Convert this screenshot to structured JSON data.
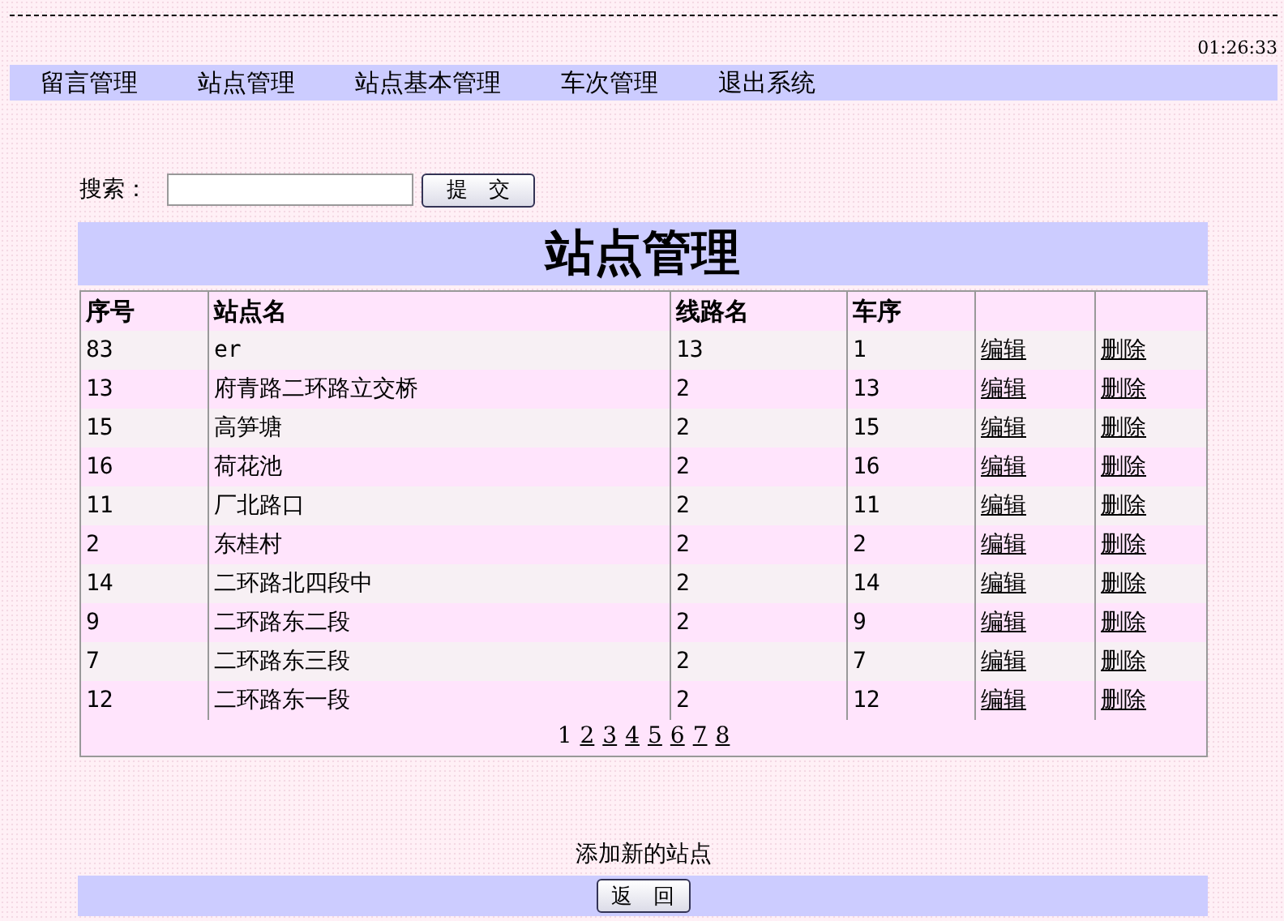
{
  "clock": "01:26:33",
  "nav": [
    "留言管理",
    "站点管理",
    "站点基本管理",
    "车次管理",
    "退出系统"
  ],
  "search": {
    "label": "搜索：",
    "button": "提　交"
  },
  "title": "站点管理",
  "table": {
    "columns": [
      "序号",
      "站点名",
      "线路名",
      "车序"
    ],
    "rows": [
      {
        "cells": [
          "83",
          "er",
          "13",
          "1"
        ],
        "actions": [
          "编辑",
          "删除"
        ]
      },
      {
        "cells": [
          "13",
          "府青路二环路立交桥",
          "2",
          "13"
        ],
        "actions": [
          "编辑",
          "删除"
        ]
      },
      {
        "cells": [
          "15",
          "高笋塘",
          "2",
          "15"
        ],
        "actions": [
          "编辑",
          "删除"
        ]
      },
      {
        "cells": [
          "16",
          "荷花池",
          "2",
          "16"
        ],
        "actions": [
          "编辑",
          "删除"
        ]
      },
      {
        "cells": [
          "11",
          "厂北路口",
          "2",
          "11"
        ],
        "actions": [
          "编辑",
          "删除"
        ]
      },
      {
        "cells": [
          "2",
          "东桂村",
          "2",
          "2"
        ],
        "actions": [
          "编辑",
          "删除"
        ]
      },
      {
        "cells": [
          "14",
          "二环路北四段中",
          "2",
          "14"
        ],
        "actions": [
          "编辑",
          "删除"
        ]
      },
      {
        "cells": [
          "9",
          "二环路东二段",
          "2",
          "9"
        ],
        "actions": [
          "编辑",
          "删除"
        ]
      },
      {
        "cells": [
          "7",
          "二环路东三段",
          "2",
          "7"
        ],
        "actions": [
          "编辑",
          "删除"
        ]
      },
      {
        "cells": [
          "12",
          "二环路东一段",
          "2",
          "12"
        ],
        "actions": [
          "编辑",
          "删除"
        ]
      }
    ]
  },
  "pages": [
    {
      "label": "1",
      "selected": true
    },
    {
      "label": "2",
      "selected": false
    },
    {
      "label": "3",
      "selected": false
    },
    {
      "label": "4",
      "selected": false
    },
    {
      "label": "5",
      "selected": false
    },
    {
      "label": "6",
      "selected": false
    },
    {
      "label": "7",
      "selected": false
    },
    {
      "label": "8",
      "selected": false
    }
  ],
  "add_link": "添加新的站点",
  "back_button": "返　回"
}
